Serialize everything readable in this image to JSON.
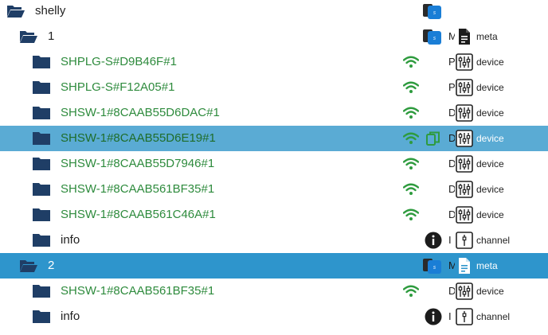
{
  "tree": {
    "root": {
      "name": "shelly"
    },
    "rows": [
      {
        "name": "1",
        "name_color": "black",
        "trunc": "M",
        "type": "meta",
        "type_icon": "document-icon",
        "status": "shelly-icon",
        "wifi": false,
        "selected": "none",
        "indent": 1,
        "folder": "open"
      },
      {
        "name": "SHPLG-S#D9B46F#1",
        "name_color": "green",
        "trunc": "P",
        "type": "device",
        "type_icon": "device-icon",
        "status": "none",
        "wifi": true,
        "selected": "none",
        "indent": 2,
        "folder": "closed"
      },
      {
        "name": "SHPLG-S#F12A05#1",
        "name_color": "green",
        "trunc": "P",
        "type": "device",
        "type_icon": "device-icon",
        "status": "none",
        "wifi": true,
        "selected": "none",
        "indent": 2,
        "folder": "closed"
      },
      {
        "name": "SHSW-1#8CAAB55D6DAC#1",
        "name_color": "green",
        "trunc": "D",
        "type": "device",
        "type_icon": "device-icon",
        "status": "none",
        "wifi": true,
        "selected": "none",
        "indent": 2,
        "folder": "closed"
      },
      {
        "name": "SHSW-1#8CAAB55D6E19#1",
        "name_color": "green",
        "trunc": "D",
        "type": "device",
        "type_icon": "device-icon",
        "status": "copy-icon",
        "wifi": true,
        "selected": "light",
        "indent": 2,
        "folder": "closed"
      },
      {
        "name": "SHSW-1#8CAAB55D7946#1",
        "name_color": "green",
        "trunc": "D",
        "type": "device",
        "type_icon": "device-icon",
        "status": "none",
        "wifi": true,
        "selected": "none",
        "indent": 2,
        "folder": "closed"
      },
      {
        "name": "SHSW-1#8CAAB561BF35#1",
        "name_color": "green",
        "trunc": "D",
        "type": "device",
        "type_icon": "device-icon",
        "status": "none",
        "wifi": true,
        "selected": "none",
        "indent": 2,
        "folder": "closed"
      },
      {
        "name": "SHSW-1#8CAAB561C46A#1",
        "name_color": "green",
        "trunc": "D",
        "type": "device",
        "type_icon": "device-icon",
        "status": "none",
        "wifi": true,
        "selected": "none",
        "indent": 2,
        "folder": "closed"
      },
      {
        "name": "info",
        "name_color": "black",
        "trunc": "I",
        "type": "channel",
        "type_icon": "channel-icon",
        "status": "info-icon",
        "wifi": false,
        "selected": "none",
        "indent": 2,
        "folder": "closed"
      },
      {
        "name": "2",
        "name_color": "black",
        "trunc": "M",
        "type": "meta",
        "type_icon": "document-icon",
        "status": "shelly-icon",
        "wifi": false,
        "selected": "dark",
        "indent": 1,
        "folder": "open"
      },
      {
        "name": "SHSW-1#8CAAB561BF35#1",
        "name_color": "green",
        "trunc": "D",
        "type": "device",
        "type_icon": "device-icon",
        "status": "none",
        "wifi": true,
        "selected": "none",
        "indent": 2,
        "folder": "closed"
      },
      {
        "name": "info",
        "name_color": "black",
        "trunc": "I",
        "type": "channel",
        "type_icon": "channel-icon",
        "status": "info-icon",
        "wifi": false,
        "selected": "none",
        "indent": 2,
        "folder": "closed"
      }
    ]
  },
  "colors": {
    "folder": "#1f3e66",
    "wifi": "#2e9b3e",
    "selected_light": "#5aabd4",
    "selected_dark": "#2e95cc"
  }
}
